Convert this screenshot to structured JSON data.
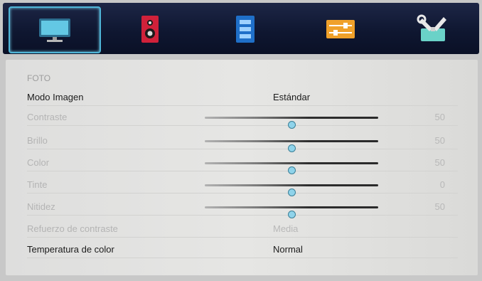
{
  "menu": {
    "tabs": [
      {
        "icon": "monitor-icon",
        "selected": true
      },
      {
        "icon": "speaker-icon",
        "selected": false
      },
      {
        "icon": "channel-list-icon",
        "selected": false
      },
      {
        "icon": "settings-sliders-icon",
        "selected": false
      },
      {
        "icon": "tools-icon",
        "selected": false
      }
    ]
  },
  "section_title": "FOTO",
  "rows": [
    {
      "label": "Modo Imagen",
      "value": "Estándar",
      "active": true
    },
    {
      "label": "Contraste",
      "value": "50",
      "slider": 50,
      "active": false
    },
    {
      "label": "Brillo",
      "value": "50",
      "slider": 50,
      "active": false
    },
    {
      "label": "Color",
      "value": "50",
      "slider": 50,
      "active": false
    },
    {
      "label": "Tinte",
      "value": "0",
      "slider": 50,
      "active": false
    },
    {
      "label": "Nitidez",
      "value": "50",
      "slider": 50,
      "active": false
    },
    {
      "label": "Refuerzo de contraste",
      "value": "Media",
      "active": false
    },
    {
      "label": "Temperatura de color",
      "value": "Normal",
      "active": true
    }
  ],
  "colors": {
    "topbar": "#0f1731",
    "selection": "#4fb6d8",
    "knob": "#8fd3ea"
  }
}
